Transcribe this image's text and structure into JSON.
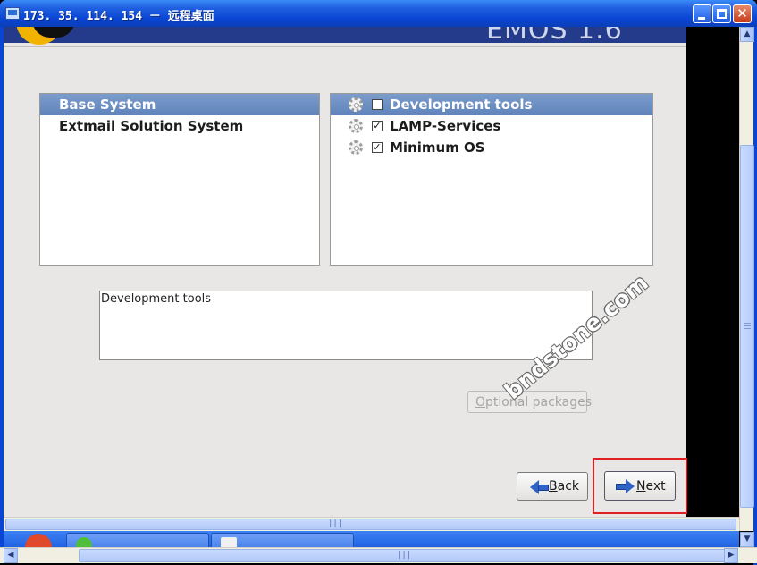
{
  "window": {
    "title": "173. 35. 114. 154 － 远程桌面",
    "minimize_icon": "minimize-icon",
    "maximize_icon": "maximize-icon",
    "close_icon": "close-icon",
    "close_glyph": "✕"
  },
  "header": {
    "logo_text": "EMOS 1.6"
  },
  "categories": [
    {
      "label": "Base System",
      "selected": true
    },
    {
      "label": "Extmail Solution System",
      "selected": false
    }
  ],
  "groups": [
    {
      "label": "Development tools",
      "checked": false,
      "selected": true,
      "mark": ""
    },
    {
      "label": "LAMP-Services",
      "checked": true,
      "selected": false,
      "mark": "✓"
    },
    {
      "label": "Minimum OS",
      "checked": true,
      "selected": false,
      "mark": "✓"
    }
  ],
  "description": {
    "text": "Development tools"
  },
  "buttons": {
    "optional_packages": {
      "mnemonic": "O",
      "rest": "ptional packages",
      "enabled": false
    },
    "back": {
      "mnemonic": "B",
      "rest": "ack"
    },
    "next": {
      "mnemonic": "N",
      "rest": "ext"
    }
  },
  "watermark": "bndstone.com",
  "scrollbars": {
    "up_arrow": "▲",
    "down_arrow": "▼",
    "left_arrow": "◀",
    "right_arrow": "▶",
    "grip": "|||"
  },
  "colors": {
    "selection": "#6f90c3",
    "highlight_box": "#e02121",
    "titlebar": "#0a46d4"
  }
}
